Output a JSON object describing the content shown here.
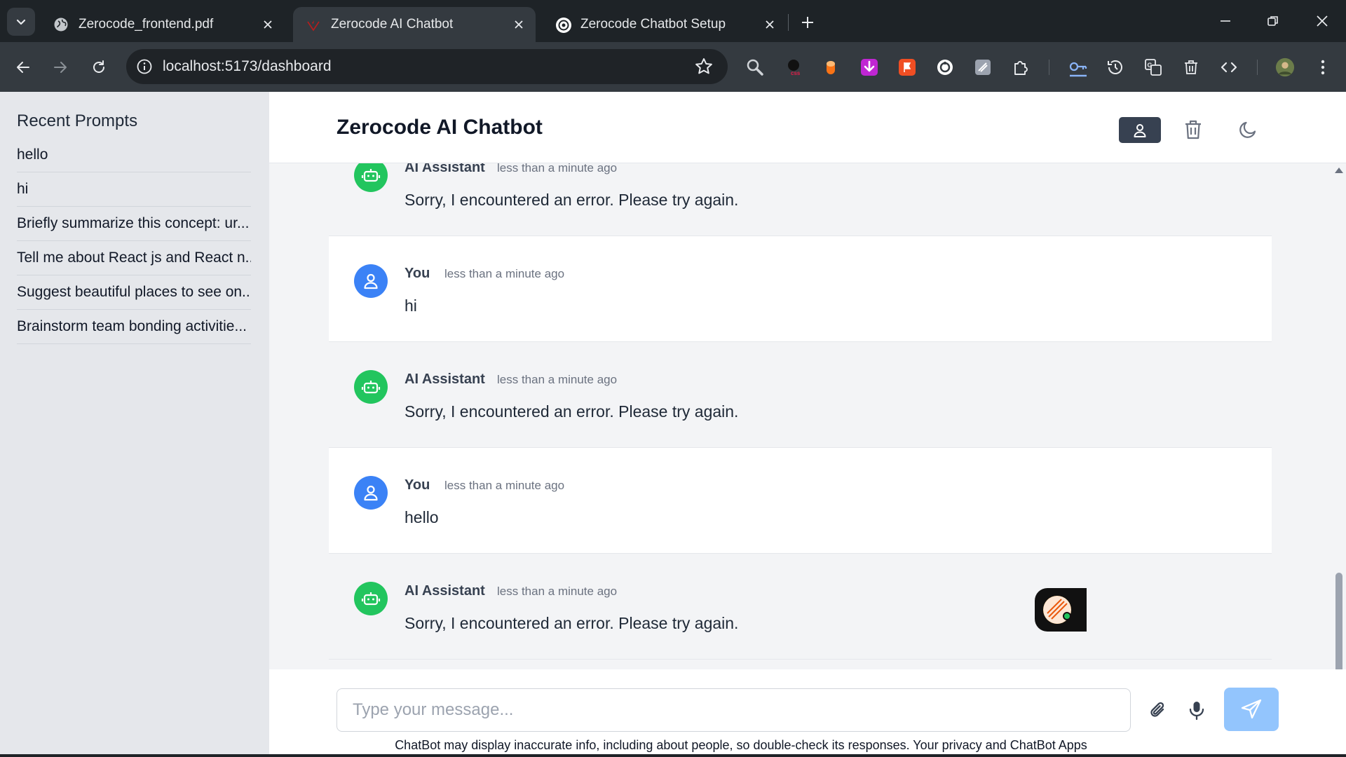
{
  "browser": {
    "tabs": [
      {
        "title": "Zerocode_frontend.pdf",
        "icon": "globe-icon",
        "active": false
      },
      {
        "title": "Zerocode AI Chatbot",
        "icon": "vite-icon",
        "active": true
      },
      {
        "title": "Zerocode Chatbot Setup",
        "icon": "openai-icon",
        "active": false
      }
    ],
    "url": "localhost:5173/dashboard"
  },
  "sidebar": {
    "title": "Recent Prompts",
    "items": [
      "hello",
      "hi",
      "Briefly summarize this concept: ur...",
      "Tell me about React js and React n...",
      "Suggest beautiful places to see on...",
      "Brainstorm team bonding activitie..."
    ]
  },
  "header": {
    "title": "Zerocode AI Chatbot"
  },
  "messages": [
    {
      "role": "ai",
      "sender": "AI Assistant",
      "time": "less than a minute ago",
      "text": "Sorry, I encountered an error. Please try again."
    },
    {
      "role": "user",
      "sender": "You",
      "time": "less than a minute ago",
      "text": "hi"
    },
    {
      "role": "ai",
      "sender": "AI Assistant",
      "time": "less than a minute ago",
      "text": "Sorry, I encountered an error. Please try again."
    },
    {
      "role": "user",
      "sender": "You",
      "time": "less than a minute ago",
      "text": "hello"
    },
    {
      "role": "ai",
      "sender": "AI Assistant",
      "time": "less than a minute ago",
      "text": "Sorry, I encountered an error. Please try again."
    }
  ],
  "composer": {
    "placeholder": "Type your message...",
    "value": "",
    "disclaimer": "ChatBot may display inaccurate info, including about people, so double-check its responses. Your privacy and ChatBot Apps"
  },
  "colors": {
    "ai_avatar": "#22c55e",
    "user_avatar": "#3b82f6",
    "send_button": "#93c5fd",
    "profile_button": "#374151"
  }
}
